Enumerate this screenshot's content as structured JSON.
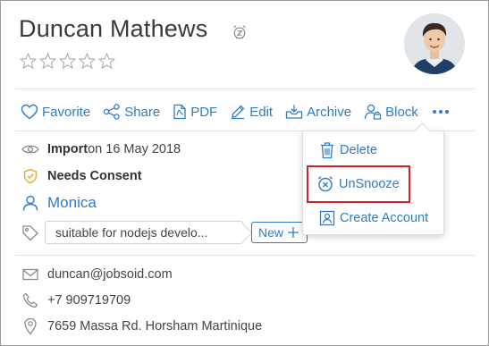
{
  "contact": {
    "name": "Duncan Mathews",
    "rating_stars": 5,
    "rating_value": 0
  },
  "toolbar": {
    "favorite": "Favorite",
    "share": "Share",
    "pdf": "PDF",
    "edit": "Edit",
    "archive": "Archive",
    "block": "Block"
  },
  "details": {
    "import_label": "Import",
    "import_date": " on 16 May 2018",
    "consent": "Needs Consent",
    "owner": "Monica",
    "tag": "suitable for nodejs develo...",
    "new_button": "New"
  },
  "menu": {
    "delete": "Delete",
    "unsnooze": "UnSnooze",
    "create_account": "Create Account"
  },
  "contact_info": {
    "email": "duncan@jobsoid.com",
    "phone": "+7 909719709",
    "address": "7659 Massa Rd. Horsham Martinique"
  },
  "colors": {
    "accent": "#2f7bc4",
    "highlight": "#d62026",
    "consent_icon": "#f0a93b"
  },
  "icons": [
    "snooze-icon",
    "star-icon",
    "heart-icon",
    "share-icon",
    "pdf-icon",
    "edit-icon",
    "archive-icon",
    "block-user-icon",
    "more-icon",
    "import-icon",
    "shield-icon",
    "user-icon",
    "tag-icon",
    "plus-icon",
    "trash-icon",
    "unsnooze-icon",
    "account-icon",
    "mail-icon",
    "phone-icon",
    "location-icon"
  ]
}
